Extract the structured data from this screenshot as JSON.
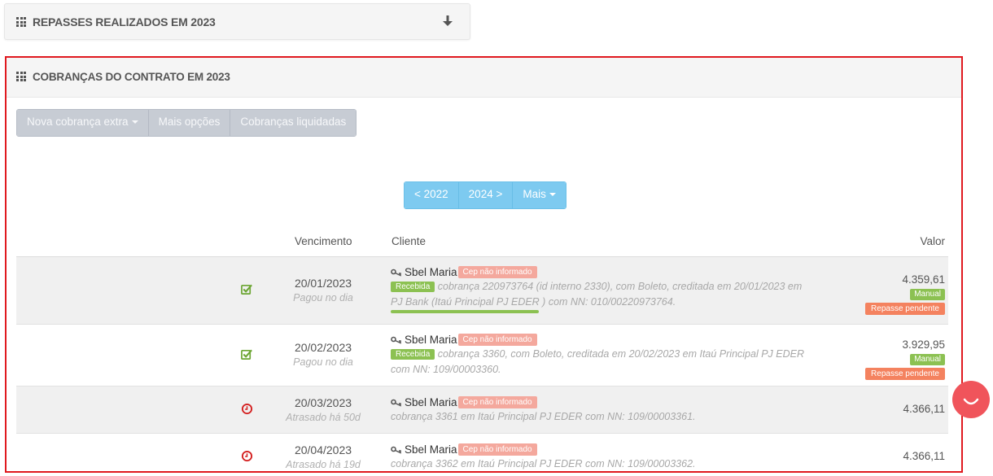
{
  "top_panel": {
    "title": "REPASSES REALIZADOS EM 2023"
  },
  "main_panel": {
    "title": "COBRANÇAS DO CONTRATO EM 2023",
    "actions": {
      "nova_cobranca": "Nova cobrança extra",
      "mais_opcoes": "Mais opções",
      "liquidadas": "Cobranças liquidadas"
    },
    "years": {
      "prev": "< 2022",
      "next": "2024 >",
      "more": "Mais"
    },
    "columns": {
      "vencimento": "Vencimento",
      "cliente": "Cliente",
      "valor": "Valor"
    },
    "rows": [
      {
        "status_icon": "check-icon",
        "date": "20/01/2023",
        "sub": "Pagou no dia",
        "client": "Sbel Maria",
        "cep": "Cep não informado",
        "badge": "Recebida",
        "desc": "cobrança 220973764 (id interno 2330), com Boleto, creditada em 20/01/2023 em PJ Bank (Itaú Principal PJ EDER ) com NN: 010/00220973764.",
        "value": "4.359,61",
        "manual": "Manual",
        "repasse": "Repasse pendente"
      },
      {
        "status_icon": "check-icon",
        "date": "20/02/2023",
        "sub": "Pagou no dia",
        "client": "Sbel Maria",
        "cep": "Cep não informado",
        "badge": "Recebida",
        "desc": "cobrança 3360, com Boleto, creditada em 20/02/2023 em Itaú Principal PJ EDER com NN: 109/00003360.",
        "value": "3.929,95",
        "manual": "Manual",
        "repasse": "Repasse pendente"
      },
      {
        "status_icon": "clock-icon",
        "date": "20/03/2023",
        "sub": "Atrasado há 50d",
        "client": "Sbel Maria",
        "cep": "Cep não informado",
        "desc": "cobrança 3361 em Itaú Principal PJ EDER com NN: 109/00003361.",
        "value": "4.366,11"
      },
      {
        "status_icon": "clock-icon",
        "date": "20/04/2023",
        "sub": "Atrasado há 19d",
        "client": "Sbel Maria",
        "cep": "Cep não informado",
        "desc": "cobrança 3362 em Itaú Principal PJ EDER com NN: 109/00003362.",
        "value": "4.366,11"
      }
    ]
  },
  "colors": {
    "highlight_border": "#e0191f",
    "green": "#8cc152",
    "orange": "#f4825f",
    "pink": "#f4a89d",
    "year_blue": "#7dcaf0",
    "chat": "#f0545b"
  }
}
